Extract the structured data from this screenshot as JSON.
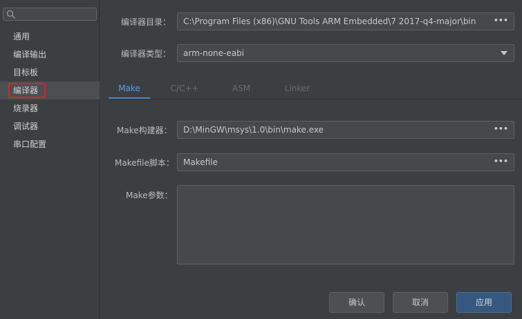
{
  "sidebar": {
    "search_placeholder": "",
    "items": [
      {
        "label": "通用"
      },
      {
        "label": "编译输出"
      },
      {
        "label": "目标板"
      },
      {
        "label": "编译器"
      },
      {
        "label": "烧录器"
      },
      {
        "label": "调试器"
      },
      {
        "label": "串口配置"
      }
    ],
    "selected_index": 3
  },
  "compiler": {
    "dir_label": "编译器目录：",
    "dir_value": "C:\\Program Files (x86)\\GNU Tools ARM Embedded\\7 2017-q4-major\\bin",
    "type_label": "编译器类型：",
    "type_value": "arm-none-eabi"
  },
  "tabs": [
    {
      "label": "Make",
      "active": true
    },
    {
      "label": "C/C++",
      "active": false
    },
    {
      "label": "ASM",
      "active": false
    },
    {
      "label": "Linker",
      "active": false
    }
  ],
  "make": {
    "builder_label": "Make构建器：",
    "builder_value": "D:\\MinGW\\msys\\1.0\\bin\\make.exe",
    "makefile_label": "Makefile脚本：",
    "makefile_value": "Makefile",
    "params_label": "Make参数：",
    "params_value": ""
  },
  "browse_glyph": "•••",
  "buttons": {
    "ok": "确认",
    "cancel": "取消",
    "apply": "应用"
  },
  "colors": {
    "accent": "#589df6",
    "selection_outline": "#e02020",
    "primary_button": "#365880"
  }
}
